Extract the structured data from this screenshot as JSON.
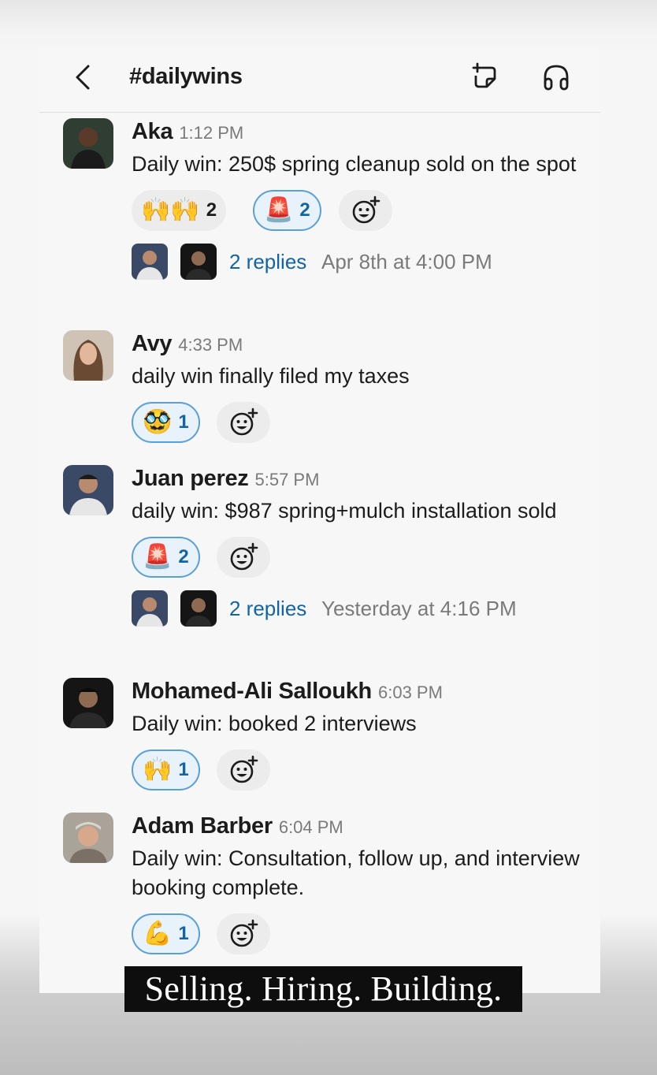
{
  "header": {
    "channel": "#dailywins",
    "icons": [
      "back-chevron-icon",
      "canvas-add-icon",
      "headphones-icon"
    ]
  },
  "messages": [
    {
      "name": "Aka",
      "time": "1:12 PM",
      "text": "Daily win: 250$ spring cleanup sold on the spot",
      "reactions": [
        {
          "emoji": "🙌🙌",
          "count": "2",
          "active": false
        },
        {
          "emoji": "🚨",
          "count": "2",
          "active": true
        }
      ],
      "thread": {
        "replies": "2 replies",
        "date": "Apr 8th at 4:00 PM"
      }
    },
    {
      "name": "Avy",
      "time": "4:33 PM",
      "text": "daily win finally filed my taxes",
      "reactions": [
        {
          "emoji": "🥸",
          "count": "1",
          "active": true
        }
      ]
    },
    {
      "name": "Juan perez",
      "time": "5:57 PM",
      "text": "daily win: $987 spring+mulch installation sold",
      "reactions": [
        {
          "emoji": "🚨",
          "count": "2",
          "active": true
        }
      ],
      "thread": {
        "replies": "2 replies",
        "date": "Yesterday at 4:16 PM"
      }
    },
    {
      "name": "Mohamed-Ali Salloukh",
      "time": "6:03 PM",
      "text": "Daily win: booked 2 interviews",
      "reactions": [
        {
          "emoji": "🙌",
          "count": "1",
          "active": true
        }
      ]
    },
    {
      "name": "Adam Barber",
      "time": "6:04 PM",
      "text": "Daily win: Consultation, follow up, and interview booking complete.",
      "reactions": [
        {
          "emoji": "💪",
          "count": "1",
          "active": true
        }
      ]
    }
  ],
  "caption": "Selling. Hiring. Building.",
  "colors": {
    "link": "#1264a3",
    "reaction_border": "#5a9fd6",
    "reaction_bg": "#e8f2fb",
    "muted": "#7a7a7a"
  }
}
